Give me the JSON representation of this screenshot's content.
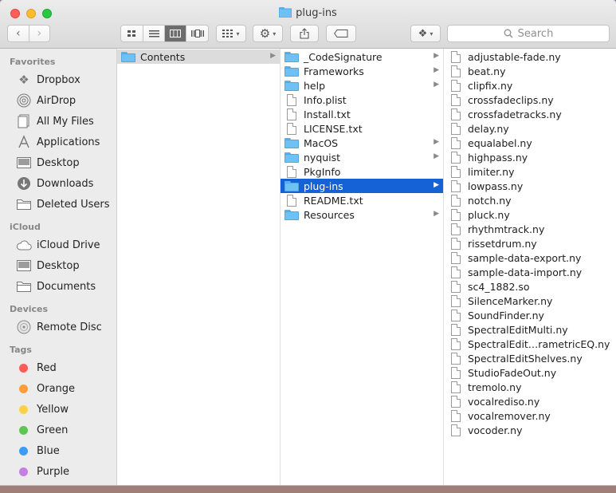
{
  "window": {
    "title": "plug-ins"
  },
  "toolbar": {
    "search_placeholder": "Search"
  },
  "sidebar": {
    "favorites_label": "Favorites",
    "favorites": [
      {
        "label": "Dropbox",
        "icon": "dropbox-icon"
      },
      {
        "label": "AirDrop",
        "icon": "airdrop-icon"
      },
      {
        "label": "All My Files",
        "icon": "all-files-icon"
      },
      {
        "label": "Applications",
        "icon": "applications-icon"
      },
      {
        "label": "Desktop",
        "icon": "desktop-icon"
      },
      {
        "label": "Downloads",
        "icon": "downloads-icon"
      },
      {
        "label": "Deleted Users",
        "icon": "folder-icon"
      }
    ],
    "icloud_label": "iCloud",
    "icloud": [
      {
        "label": "iCloud Drive",
        "icon": "cloud-icon"
      },
      {
        "label": "Desktop",
        "icon": "desktop-icon"
      },
      {
        "label": "Documents",
        "icon": "documents-icon"
      }
    ],
    "devices_label": "Devices",
    "devices": [
      {
        "label": "Remote Disc",
        "icon": "disc-icon"
      }
    ],
    "tags_label": "Tags",
    "tags": [
      {
        "label": "Red",
        "color": "#fc5b57"
      },
      {
        "label": "Orange",
        "color": "#fd9d3a"
      },
      {
        "label": "Yellow",
        "color": "#fdd146"
      },
      {
        "label": "Green",
        "color": "#5fc552"
      },
      {
        "label": "Blue",
        "color": "#3e9bf5"
      },
      {
        "label": "Purple",
        "color": "#c67ee0"
      }
    ]
  },
  "columns": {
    "col1": [
      {
        "label": "Contents",
        "type": "folder",
        "chevron": true,
        "state": "gray"
      }
    ],
    "col2": [
      {
        "label": "_CodeSignature",
        "type": "folder",
        "chevron": true
      },
      {
        "label": "Frameworks",
        "type": "folder",
        "chevron": true
      },
      {
        "label": "help",
        "type": "folder",
        "chevron": true
      },
      {
        "label": "Info.plist",
        "type": "file"
      },
      {
        "label": "Install.txt",
        "type": "file"
      },
      {
        "label": "LICENSE.txt",
        "type": "file"
      },
      {
        "label": "MacOS",
        "type": "folder",
        "chevron": true
      },
      {
        "label": "nyquist",
        "type": "folder",
        "chevron": true
      },
      {
        "label": "PkgInfo",
        "type": "file"
      },
      {
        "label": "plug-ins",
        "type": "folder",
        "chevron": true,
        "state": "blue"
      },
      {
        "label": "README.txt",
        "type": "file"
      },
      {
        "label": "Resources",
        "type": "folder",
        "chevron": true
      }
    ],
    "col3": [
      {
        "label": "adjustable-fade.ny",
        "type": "file"
      },
      {
        "label": "beat.ny",
        "type": "file"
      },
      {
        "label": "clipfix.ny",
        "type": "file"
      },
      {
        "label": "crossfadeclips.ny",
        "type": "file"
      },
      {
        "label": "crossfadetracks.ny",
        "type": "file"
      },
      {
        "label": "delay.ny",
        "type": "file"
      },
      {
        "label": "equalabel.ny",
        "type": "file"
      },
      {
        "label": "highpass.ny",
        "type": "file"
      },
      {
        "label": "limiter.ny",
        "type": "file"
      },
      {
        "label": "lowpass.ny",
        "type": "file"
      },
      {
        "label": "notch.ny",
        "type": "file"
      },
      {
        "label": "pluck.ny",
        "type": "file"
      },
      {
        "label": "rhythmtrack.ny",
        "type": "file"
      },
      {
        "label": "rissetdrum.ny",
        "type": "file"
      },
      {
        "label": "sample-data-export.ny",
        "type": "file"
      },
      {
        "label": "sample-data-import.ny",
        "type": "file"
      },
      {
        "label": "sc4_1882.so",
        "type": "file"
      },
      {
        "label": "SilenceMarker.ny",
        "type": "file"
      },
      {
        "label": "SoundFinder.ny",
        "type": "file"
      },
      {
        "label": "SpectralEditMulti.ny",
        "type": "file"
      },
      {
        "label": "SpectralEdit…rametricEQ.ny",
        "type": "file"
      },
      {
        "label": "SpectralEditShelves.ny",
        "type": "file"
      },
      {
        "label": "StudioFadeOut.ny",
        "type": "file"
      },
      {
        "label": "tremolo.ny",
        "type": "file"
      },
      {
        "label": "vocalrediso.ny",
        "type": "file"
      },
      {
        "label": "vocalremover.ny",
        "type": "file"
      },
      {
        "label": "vocoder.ny",
        "type": "file"
      }
    ]
  }
}
